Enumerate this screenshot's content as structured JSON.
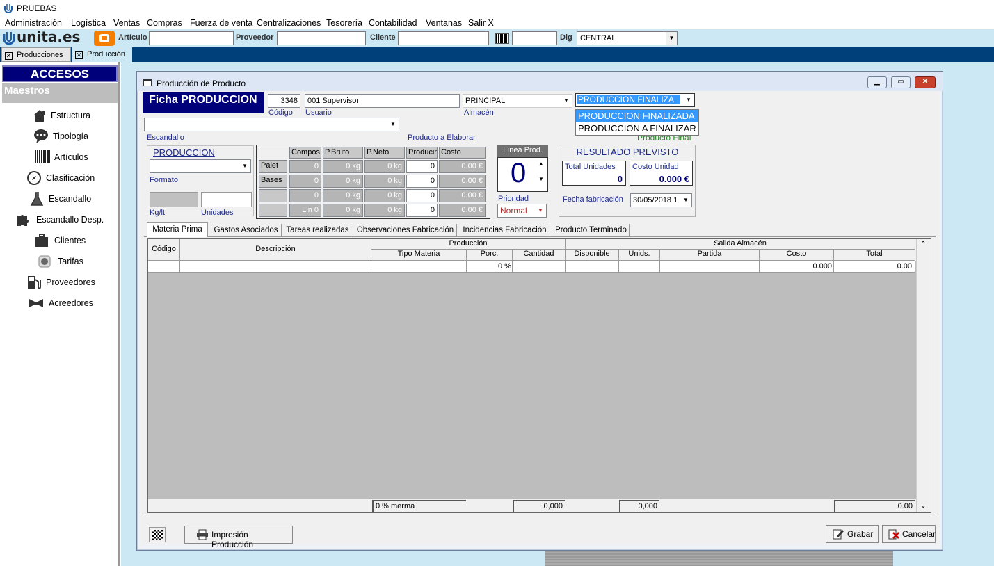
{
  "app": {
    "title": "PRUEBAS"
  },
  "menu": [
    "Administración",
    "Logística",
    "Ventas",
    "Compras",
    "Fuerza de venta",
    "Centralizaciones",
    "Tesorería",
    "Contabilidad",
    "Ventanas",
    "Salir X"
  ],
  "toolbar": {
    "logo_text": "unita.es",
    "articulo_label": "Artículo",
    "proveedor_label": "Proveedor",
    "cliente_label": "Cliente",
    "dlg_label": "Dlg",
    "dlg_value": "CENTRAL"
  },
  "doc_tabs": [
    "Producciones",
    "Producción"
  ],
  "quick_access": {
    "title": "ACCESOS RAPIDOS",
    "section": "Maestros",
    "items": [
      {
        "label": "Estructura",
        "icon": "house-icon"
      },
      {
        "label": "Tipología",
        "icon": "speech-bubble-icon"
      },
      {
        "label": "Artículos",
        "icon": "barcode-icon"
      },
      {
        "label": "Clasificación",
        "icon": "compass-icon"
      },
      {
        "label": "Escandallo",
        "icon": "flask-icon"
      },
      {
        "label": "Escandallo Desp.",
        "icon": "puzzle-icon"
      },
      {
        "label": "Clientes",
        "icon": "briefcase-icon"
      },
      {
        "label": "Tarifas",
        "icon": "tariff-icon"
      },
      {
        "label": "Proveedores",
        "icon": "fuel-pump-icon"
      },
      {
        "label": "Acreedores",
        "icon": "bowtie-icon"
      }
    ]
  },
  "window": {
    "title": "Producción de Producto",
    "ficha_title": "Ficha PRODUCCION",
    "codigo_value": "3348",
    "codigo_label": "Código",
    "usuario_value": "001 Supervisor",
    "usuario_label": "Usuario",
    "almacen_value": "PRINCIPAL",
    "almacen_label": "Almacén",
    "estado_value": "PRODUCCION FINALIZA",
    "estado_options": [
      "PRODUCCION FINALIZADA",
      "PRODUCCION A FINALIZAR"
    ],
    "producto_final_label": "Producto Final",
    "escandallo_label": "Escandallo",
    "producto_elaborar_label": "Producto a Elaborar",
    "produccion_label": "PRODUCCION",
    "formato_label": "Formato",
    "kglt_label": "Kg/lt",
    "unidades_label": "Unidades",
    "comp_table": {
      "headers": [
        "Compos.",
        "P.Bruto",
        "P.Neto",
        "Producir",
        "Costo"
      ],
      "rows": [
        {
          "label": "Palet",
          "compos": "0",
          "bruto": "0 kg",
          "neto": "0 kg",
          "producir": "0",
          "costo": "0.00 €"
        },
        {
          "label": "Bases",
          "compos": "0",
          "bruto": "0 kg",
          "neto": "0 kg",
          "producir": "0",
          "costo": "0.00 €"
        },
        {
          "label": "",
          "compos": "0",
          "bruto": "0 kg",
          "neto": "0 kg",
          "producir": "0",
          "costo": "0.00 €"
        },
        {
          "label": "",
          "compos": "Lin 0",
          "bruto": "0 kg",
          "neto": "0 kg",
          "producir": "0",
          "costo": "0.00 €"
        }
      ]
    },
    "linea_prod_label": "Línea Prod.",
    "linea_prod_value": "0",
    "prioridad_label": "Prioridad",
    "prioridad_value": "Normal",
    "resultado_title": "RESULTADO PREVISTO",
    "total_unidades_label": "Total Unidades",
    "total_unidades_value": "0",
    "costo_unidad_label": "Costo Unidad",
    "costo_unidad_value": "0.000 €",
    "fecha_label": "Fecha fabricación",
    "fecha_value": "30/05/2018 1",
    "tabs": [
      "Materia Prima",
      "Gastos Asociados",
      "Tareas realizadas",
      "Observaciones Fabricación",
      "Incidencias Fabricación",
      "Producto Terminado"
    ],
    "grid": {
      "group_produccion": "Producción",
      "group_salida": "Salida Almacén",
      "col_codigo": "Código",
      "col_descripcion": "Descripción",
      "cols": [
        "Tipo Materia",
        "Porc.",
        "Cantidad",
        "Disponible",
        "Unids.",
        "Partida",
        "Costo",
        "Total"
      ],
      "row": {
        "porc": "0 %",
        "costo": "0.000",
        "total": "0.00"
      },
      "footer": {
        "merma": "0 % merma",
        "cantidad": "0,000",
        "disponible": "0,000",
        "total": "0.00"
      }
    },
    "print_button": "Impresión Producción",
    "save_button": "Grabar",
    "cancel_button": "Cancelar"
  }
}
